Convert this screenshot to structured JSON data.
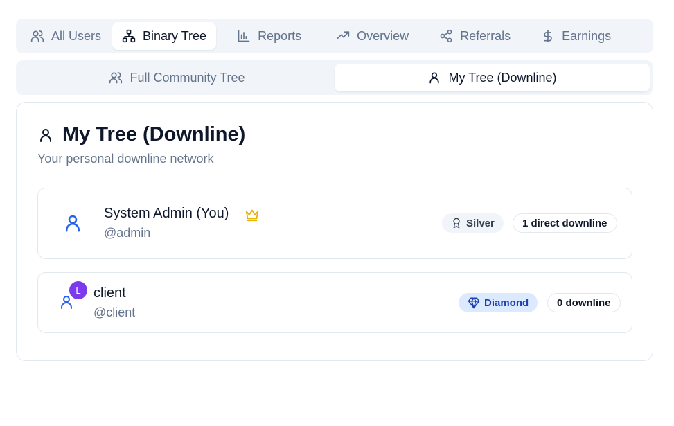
{
  "main_tabs": [
    {
      "label": "All Users",
      "icon": "users-icon"
    },
    {
      "label": "Binary Tree",
      "icon": "sitemap-icon"
    },
    {
      "label": "Reports",
      "icon": "bar-chart-icon"
    },
    {
      "label": "Overview",
      "icon": "trending-up-icon"
    },
    {
      "label": "Referrals",
      "icon": "share-icon"
    },
    {
      "label": "Earnings",
      "icon": "dollar-icon"
    }
  ],
  "sub_tabs": [
    {
      "label": "Full Community Tree",
      "icon": "users-icon"
    },
    {
      "label": "My Tree (Downline)",
      "icon": "user-icon"
    }
  ],
  "card": {
    "title": "My Tree (Downline)",
    "subtitle": "Your personal downline network"
  },
  "nodes": [
    {
      "name": "System Admin (You)",
      "handle": "@admin",
      "rank": "Silver",
      "downline": "1 direct downline",
      "crown_color": "#eab308"
    },
    {
      "name": "client",
      "handle": "@client",
      "avatar_letter": "L",
      "rank": "Diamond",
      "downline": "0 downline"
    }
  ],
  "colors": {
    "accent_blue": "#2563eb",
    "avatar_purple": "#7c3aed",
    "diamond_bg": "#dbeafe"
  }
}
